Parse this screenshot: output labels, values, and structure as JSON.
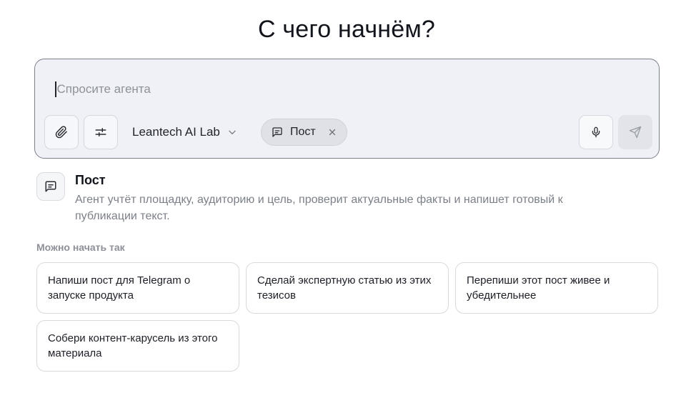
{
  "heading": "С чего начнём?",
  "composer": {
    "placeholder": "Спросите агента",
    "model_label": "Leantech AI Lab",
    "chip_label": "Пост"
  },
  "selected_mode": {
    "title": "Пост",
    "description": "Агент учтёт площадку, аудиторию и цель, проверит актуальные факты и напишет готовый к публикации текст."
  },
  "suggestions": {
    "label": "Можно начать так",
    "items": [
      "Напиши пост для Telegram о запуске продукта",
      "Сделай экспертную статью из этих тезисов",
      "Перепиши этот пост живее и убедительнее",
      "Собери контент-карусель из этого материала"
    ]
  },
  "icons": {
    "attach": "paperclip-icon",
    "tools": "sliders-icon",
    "model_dropdown": "chevron-down-icon",
    "chip": "message-square-icon",
    "chip_remove": "close-icon",
    "mic": "microphone-icon",
    "send": "send-icon"
  },
  "colors": {
    "composer_bg": "#eff1f6",
    "composer_border": "#7c8089",
    "chip_bg": "#dfe1e7",
    "send_disabled_bg": "#e2e4e9"
  }
}
